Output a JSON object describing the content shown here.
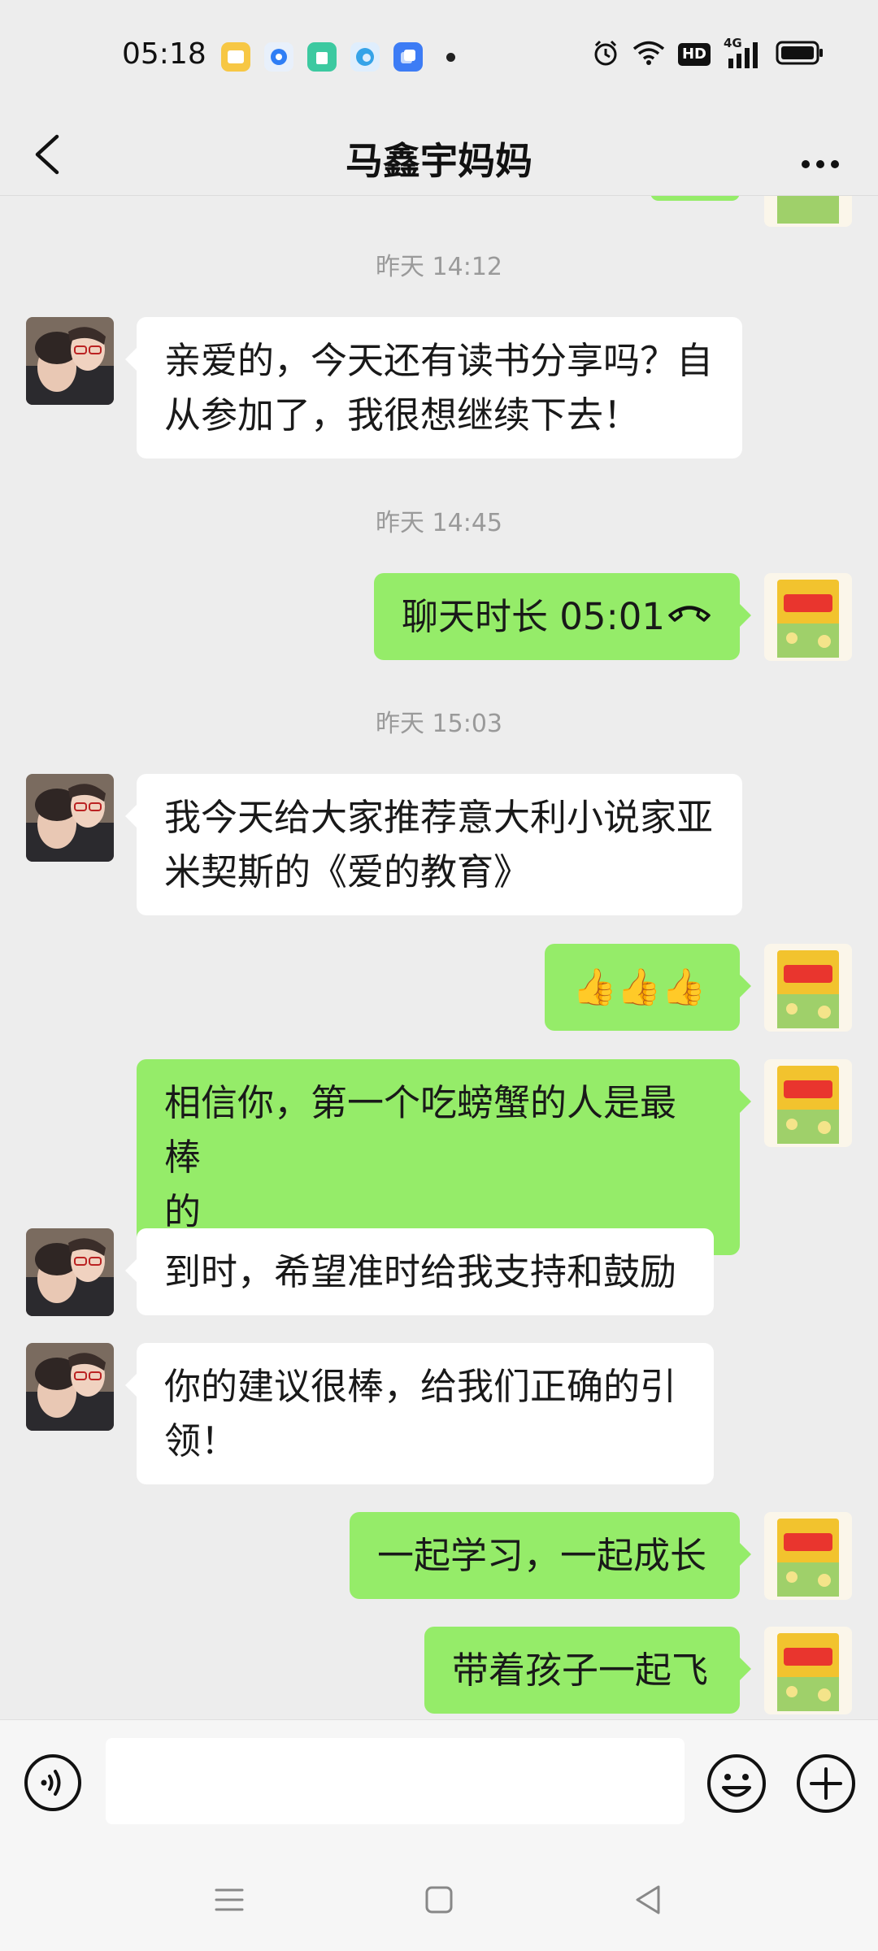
{
  "status_bar": {
    "time": "05:18",
    "app_icons": [
      "notes-app-icon",
      "browser-app-icon",
      "store-app-icon",
      "edge-app-icon",
      "files-app-icon"
    ],
    "indicators": [
      "alarm-icon",
      "wifi-icon",
      "hd-icon",
      "signal-4g-icon",
      "battery-icon"
    ],
    "hd_label": "HD",
    "network_label": "4G"
  },
  "header": {
    "title": "马鑫宇妈妈"
  },
  "messages": [
    {
      "type": "timestamp",
      "text": "昨天 14:12"
    },
    {
      "type": "text",
      "from": "them",
      "lines": [
        "亲爱的，今天还有读书分享吗？自",
        "从参加了，我很想继续下去！"
      ]
    },
    {
      "type": "timestamp",
      "text": "昨天 14:45"
    },
    {
      "type": "call",
      "from": "me",
      "text": "聊天时长 05:01"
    },
    {
      "type": "timestamp",
      "text": "昨天 15:03"
    },
    {
      "type": "text",
      "from": "them",
      "lines": [
        "我今天给大家推荐意大利小说家亚",
        "米契斯的《爱的教育》"
      ]
    },
    {
      "type": "emoji",
      "from": "me",
      "emoji": "👍👍👍"
    },
    {
      "type": "text",
      "from": "me",
      "lines": [
        "相信你，第一个吃螃蟹的人是最棒",
        "的"
      ]
    },
    {
      "type": "text",
      "from": "them",
      "lines": [
        "到时，希望准时给我支持和鼓励"
      ]
    },
    {
      "type": "text",
      "from": "them",
      "lines": [
        "你的建议很棒，给我们正确的引",
        "领！"
      ]
    },
    {
      "type": "text",
      "from": "me",
      "lines": [
        "一起学习，一起成长"
      ]
    },
    {
      "type": "text",
      "from": "me",
      "lines": [
        "带着孩子一起飞"
      ]
    }
  ],
  "input_bar": {
    "text_value": "",
    "icons": [
      "voice-icon",
      "emoji-icon",
      "plus-icon"
    ]
  },
  "system_nav": [
    "menu-icon",
    "home-icon",
    "back-icon"
  ],
  "colors": {
    "background": "#ededed",
    "bubble_out": "#95ec69",
    "bubble_in": "#ffffff",
    "timestamp": "#9a9a9a"
  }
}
